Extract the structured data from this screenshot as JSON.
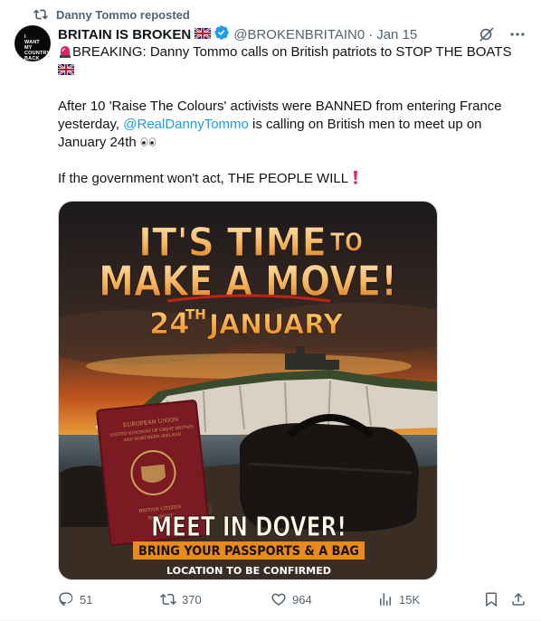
{
  "repost": {
    "label": "Danny Tommo reposted",
    "icon": "repost-icon"
  },
  "author": {
    "avatar_lines": [
      "I",
      "WANT",
      "MY",
      "COUNTRY",
      "BACK"
    ],
    "name": "BRITAIN IS BROKEN",
    "flag": "uk-flag-icon",
    "handle": "@BROKENBRITAIN0",
    "dot": "·",
    "date": "Jan 15"
  },
  "body": {
    "line1": "BREAKING: Danny Tommo calls on British patriots to STOP THE BOATS",
    "para2_a": "After 10 'Raise The Colours' activists were BANNED from entering France yesterday, ",
    "mention": "@RealDannyTommo",
    "para2_b": " is calling on British men to meet up on January 24th",
    "para3": "If the government won't act, THE PEOPLE WILL"
  },
  "media": {
    "headline1_a": "IT'S TIME",
    "headline1_b": "TO",
    "headline2": "MAKE A MOVE!",
    "date_num": "24",
    "date_sup": "TH",
    "date_month": "JANUARY",
    "passport_line1": "EUROPEAN UNION",
    "passport_line2": "UNITED KINGDOM OF GREAT BRITAIN",
    "passport_line3": "AND NORTHERN IRELAND",
    "passport_line4": "BRITISH CITIZEN",
    "passport_line5": "PASSPORT",
    "meet": "MEET IN DOVER!",
    "bring": "BRING YOUR PASSPORTS & A BAG",
    "location": "LOCATION TO BE CONFIRMED"
  },
  "actions": {
    "replies": "51",
    "reposts": "370",
    "likes": "964",
    "views": "15K"
  },
  "colors": {
    "accent": "#1d9bf0",
    "muted": "#536471",
    "headline_orange": "#f2a33a",
    "banner_orange": "#e88a1c"
  }
}
